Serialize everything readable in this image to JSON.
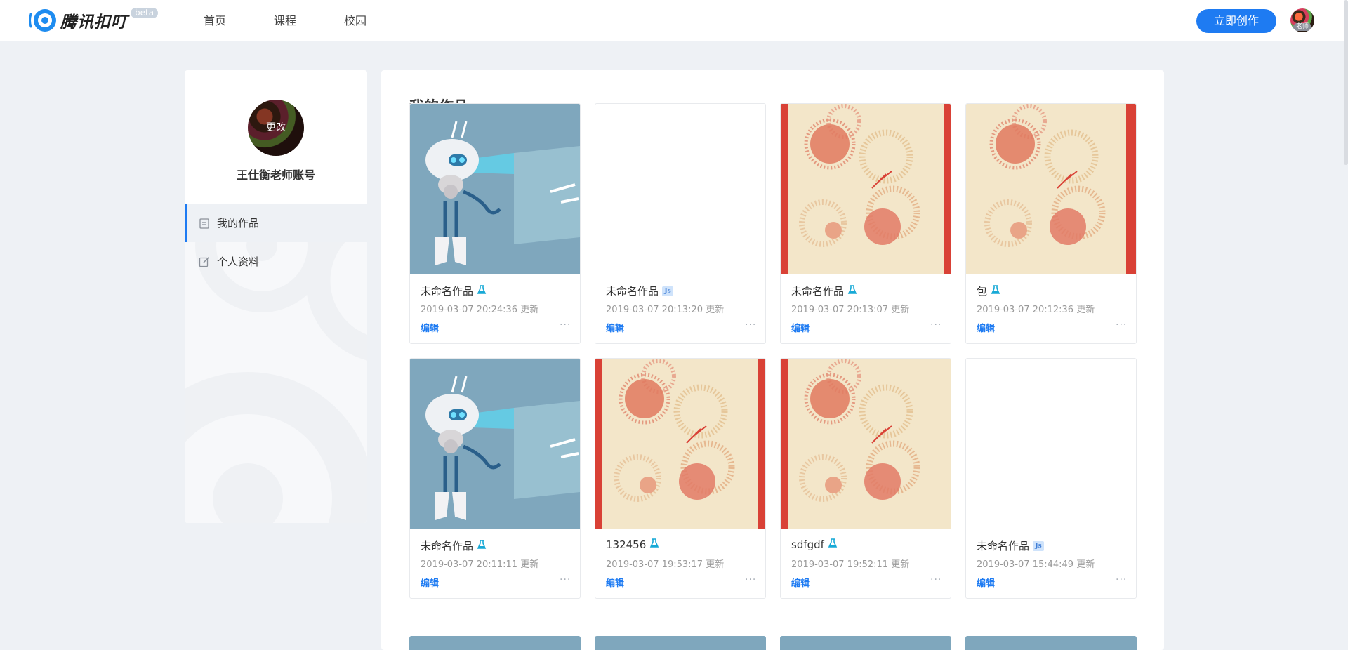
{
  "header": {
    "brand": "腾讯扣叮",
    "beta": "beta",
    "nav": [
      "首页",
      "课程",
      "校园"
    ],
    "create_label": "立即创作",
    "avatar_tag": "老师"
  },
  "sidebar": {
    "avatar_action": "更改",
    "username": "王仕衡老师账号",
    "items": [
      {
        "label": "我的作品",
        "icon": "clipboard-icon",
        "active": true
      },
      {
        "label": "个人资料",
        "icon": "edit-icon",
        "active": false
      }
    ]
  },
  "main": {
    "title": "我的作品",
    "edit_label": "编辑",
    "more_label": "···",
    "cards": [
      {
        "title": "未命名作品",
        "time": "2019-03-07 20:24:36 更新",
        "thumb": "robot",
        "badge": "lab"
      },
      {
        "title": "未命名作品",
        "time": "2019-03-07 20:13:20 更新",
        "thumb": "blank",
        "badge": "js"
      },
      {
        "title": "未命名作品",
        "time": "2019-03-07 20:13:07 更新",
        "thumb": "floral",
        "badge": "lab"
      },
      {
        "title": "包",
        "time": "2019-03-07 20:12:36 更新",
        "thumb": "floral",
        "badge": "lab"
      },
      {
        "title": "未命名作品",
        "time": "2019-03-07 20:11:11 更新",
        "thumb": "robot",
        "badge": "lab"
      },
      {
        "title": "132456",
        "time": "2019-03-07 19:53:17 更新",
        "thumb": "floral",
        "badge": "lab"
      },
      {
        "title": "sdfgdf",
        "time": "2019-03-07 19:52:11 更新",
        "thumb": "floral",
        "badge": "lab"
      },
      {
        "title": "未命名作品",
        "time": "2019-03-07 15:44:49 更新",
        "thumb": "blank",
        "badge": "js"
      }
    ],
    "js_badge": "Js"
  },
  "colors": {
    "accent": "#1e7bf2",
    "badge_cyan": "#17a9d6",
    "robot_bg": "#7fa7bd",
    "floral_bg": "#f3e6c9",
    "floral_border": "#d94136"
  }
}
